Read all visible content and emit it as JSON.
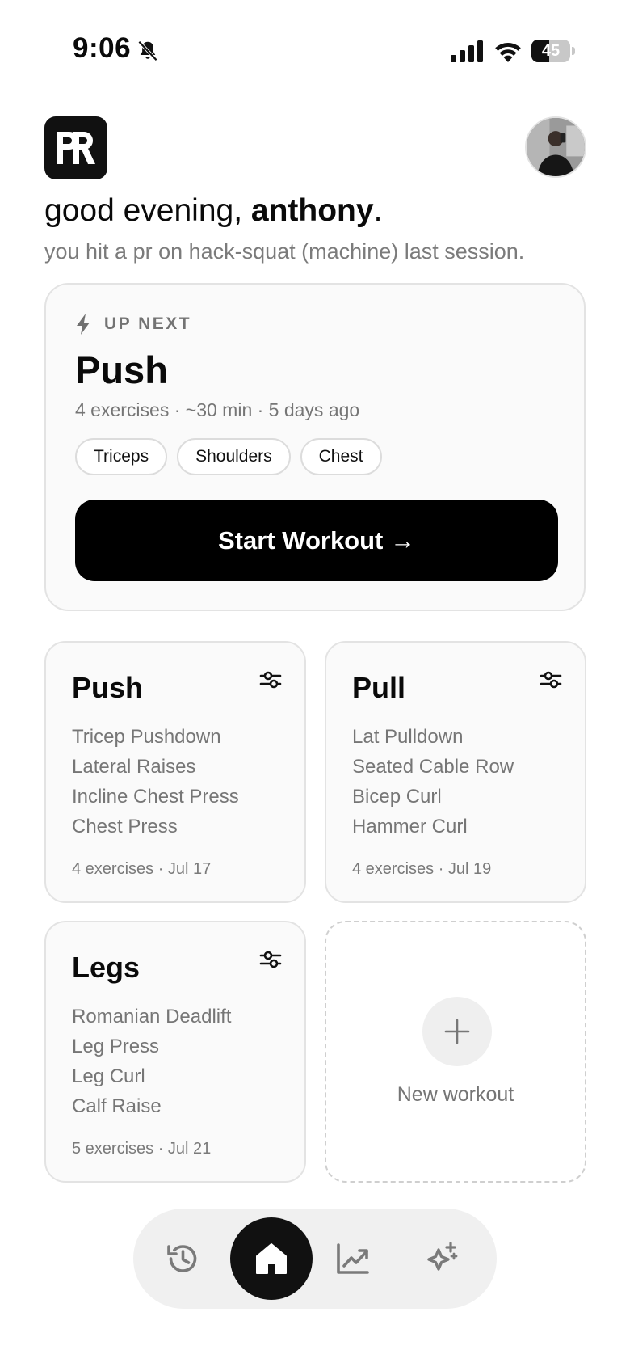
{
  "status_bar": {
    "time": "9:06",
    "battery_level": "45",
    "battery_fraction": 0.45,
    "icons": [
      "bell-slash-icon",
      "signal-icon",
      "wifi-icon",
      "battery-icon"
    ]
  },
  "header": {
    "logo_text": "PR",
    "avatar": "profile-photo",
    "greeting_prefix": "good evening, ",
    "user_name": "anthony",
    "greeting_suffix": ".",
    "subline": "you hit a pr on hack-squat (machine) last session."
  },
  "up_next": {
    "label": "UP NEXT",
    "title": "Push",
    "meta": "4 exercises · ~30 min · 5 days ago",
    "tags": [
      "Triceps",
      "Shoulders",
      "Chest"
    ],
    "start_label": "Start Workout →"
  },
  "workouts": [
    {
      "title": "Push",
      "exercises": [
        "Tricep Pushdown",
        "Lateral Raises",
        "Incline Chest Press",
        "Chest Press"
      ],
      "footer": "4 exercises · Jul 17"
    },
    {
      "title": "Pull",
      "exercises": [
        "Lat Pulldown",
        "Seated Cable Row",
        "Bicep Curl",
        "Hammer Curl"
      ],
      "footer": "4 exercises · Jul 19"
    },
    {
      "title": "Legs",
      "exercises": [
        "Romanian Deadlift",
        "Leg Press",
        "Leg Curl",
        "Calf Raise"
      ],
      "footer": "5 exercises · Jul 21"
    }
  ],
  "new_workout": {
    "label": "New workout"
  },
  "nav": {
    "items": [
      "history-icon",
      "home-icon",
      "chart-icon",
      "sparkles-icon"
    ],
    "active": "home-icon"
  },
  "colors": {
    "accent": "#000000",
    "card_bg": "#fafafa",
    "border": "#e3e3e3",
    "muted_text": "#767676",
    "nav_bg": "#f0f0f0"
  }
}
